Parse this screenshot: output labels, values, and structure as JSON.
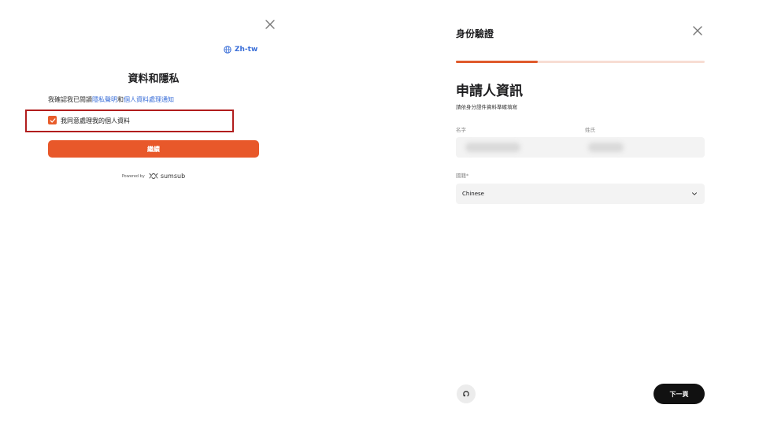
{
  "left_panel": {
    "language": "Zh-tw",
    "title": "資料和隱私",
    "consent": {
      "prefix": "我確認我已閱讀",
      "privacy_link": "隱私聲明",
      "conjunction": "和",
      "notice_link": "個人資料處理通知"
    },
    "checkbox_label": "我同意處理我的個人資料",
    "checkbox_checked": true,
    "continue_label": "繼續",
    "powered_by": "Powered by",
    "brand": "sumsub"
  },
  "right_panel": {
    "header_title": "身份驗證",
    "progress": 0.33,
    "page_title": "申請人資訊",
    "subtitle": "請依身分證件資料準確填寫",
    "first_name_label": "名字",
    "last_name_label": "姓氏",
    "nationality_label": "國籍*",
    "nationality_value": "Chinese",
    "next_label": "下一頁"
  },
  "colors": {
    "accent": "#e8582a",
    "link": "#3b6fd8",
    "highlight_border": "#b11d1d",
    "progress_track": "#f7ddd3",
    "next_button": "#111111"
  },
  "icons": [
    "close-icon",
    "globe-icon",
    "check-icon",
    "sumsub-logo-icon",
    "chevron-down-icon",
    "refresh-icon"
  ]
}
